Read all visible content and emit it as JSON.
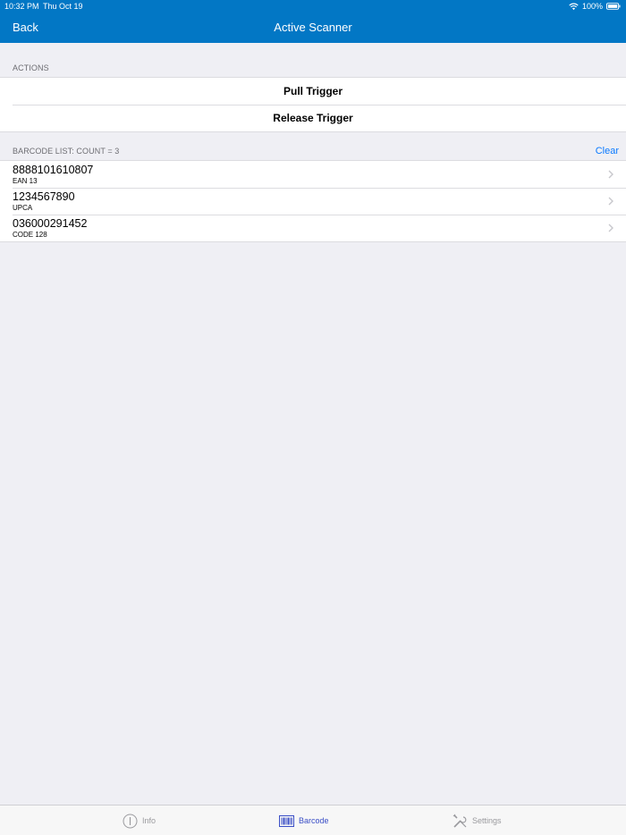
{
  "status_bar": {
    "time": "10:32 PM",
    "date": "Thu Oct 19",
    "battery": "100%",
    "wifi_icon": "wifi-icon",
    "battery_icon": "battery-icon"
  },
  "nav": {
    "back_label": "Back",
    "title": "Active Scanner"
  },
  "actions": {
    "header": "ACTIONS",
    "items": [
      {
        "label": "Pull Trigger"
      },
      {
        "label": "Release Trigger"
      }
    ]
  },
  "barcode_list": {
    "header": "BARCODE LIST: COUNT = 3",
    "clear_label": "Clear",
    "items": [
      {
        "value": "8888101610807",
        "type": "EAN 13"
      },
      {
        "value": "1234567890",
        "type": "UPCA"
      },
      {
        "value": "036000291452",
        "type": "CODE 128"
      }
    ]
  },
  "tabs": [
    {
      "label": "Info",
      "icon": "info-icon",
      "active": false
    },
    {
      "label": "Barcode",
      "icon": "barcode-icon",
      "active": true
    },
    {
      "label": "Settings",
      "icon": "tools-icon",
      "active": false
    }
  ],
  "colors": {
    "accent": "#0277c5",
    "link": "#0a7aff",
    "active_tab": "#3a4ec6",
    "background": "#efeff4"
  }
}
